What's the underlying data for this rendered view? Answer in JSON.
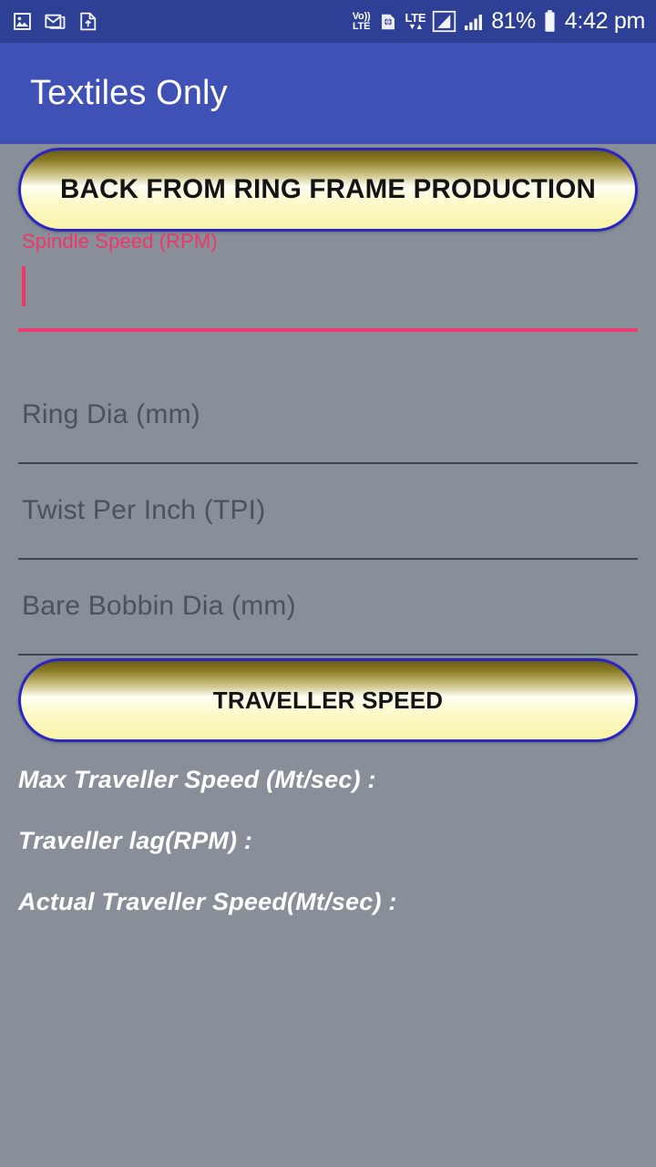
{
  "status_bar": {
    "background": "#2E4095",
    "left_icons": [
      {
        "name": "image-icon",
        "glyph": "photo"
      },
      {
        "name": "email-icon",
        "glyph": "envelope"
      },
      {
        "name": "document-upload-icon",
        "glyph": "document"
      }
    ],
    "right_icons": [
      {
        "name": "volte-icon",
        "line1": "Vo))",
        "line2": "LTE"
      },
      {
        "name": "sim-globe-icon",
        "glyph": "globe"
      },
      {
        "name": "lte-data-icon",
        "label": "LTE",
        "arrows": "↓↑"
      },
      {
        "name": "signal-strength-primary-icon",
        "glyph": "bars-boxed"
      },
      {
        "name": "signal-strength-secondary-icon",
        "glyph": "bars"
      }
    ],
    "battery_percent": "81%",
    "battery_icon": "battery-icon",
    "clock": "4:42 pm"
  },
  "app_bar": {
    "title": "Textiles Only",
    "background": "#3F51B5",
    "title_color": "#FFFFFF"
  },
  "theme": {
    "page_background": "#888F99",
    "accent_pink": "#EE3C72",
    "label_pink": "#F0356A",
    "underline_inactive": "#3A4750",
    "button_border": "#2A24C4",
    "button_text": "#141414",
    "result_text": "#FFFFFF"
  },
  "main": {
    "back_button_label": "BACK FROM RING FRAME PRODUCTION",
    "calculate_button_label": "TRAVELLER SPEED",
    "fields": [
      {
        "name": "spindle-speed",
        "label": "Spindle Speed (RPM)",
        "placeholder": "Spindle Speed (RPM)",
        "value": "",
        "focused": true
      },
      {
        "name": "ring-dia",
        "label": "Ring Dia (mm)",
        "placeholder": "Ring Dia (mm)",
        "value": "",
        "focused": false
      },
      {
        "name": "twist-per-inch",
        "label": "Twist Per Inch (TPI)",
        "placeholder": "Twist Per Inch (TPI)",
        "value": "",
        "focused": false
      },
      {
        "name": "bare-bobbin-dia",
        "label": "Bare Bobbin Dia (mm)",
        "placeholder": "Bare Bobbin Dia (mm)",
        "value": "",
        "focused": false
      }
    ],
    "results": [
      {
        "name": "max-traveller-speed",
        "label": "Max Traveller Speed (Mt/sec) :",
        "value": ""
      },
      {
        "name": "traveller-lag",
        "label": "Traveller lag(RPM) :",
        "value": ""
      },
      {
        "name": "actual-traveller-speed",
        "label": "Actual Traveller Speed(Mt/sec) :",
        "value": ""
      }
    ]
  }
}
